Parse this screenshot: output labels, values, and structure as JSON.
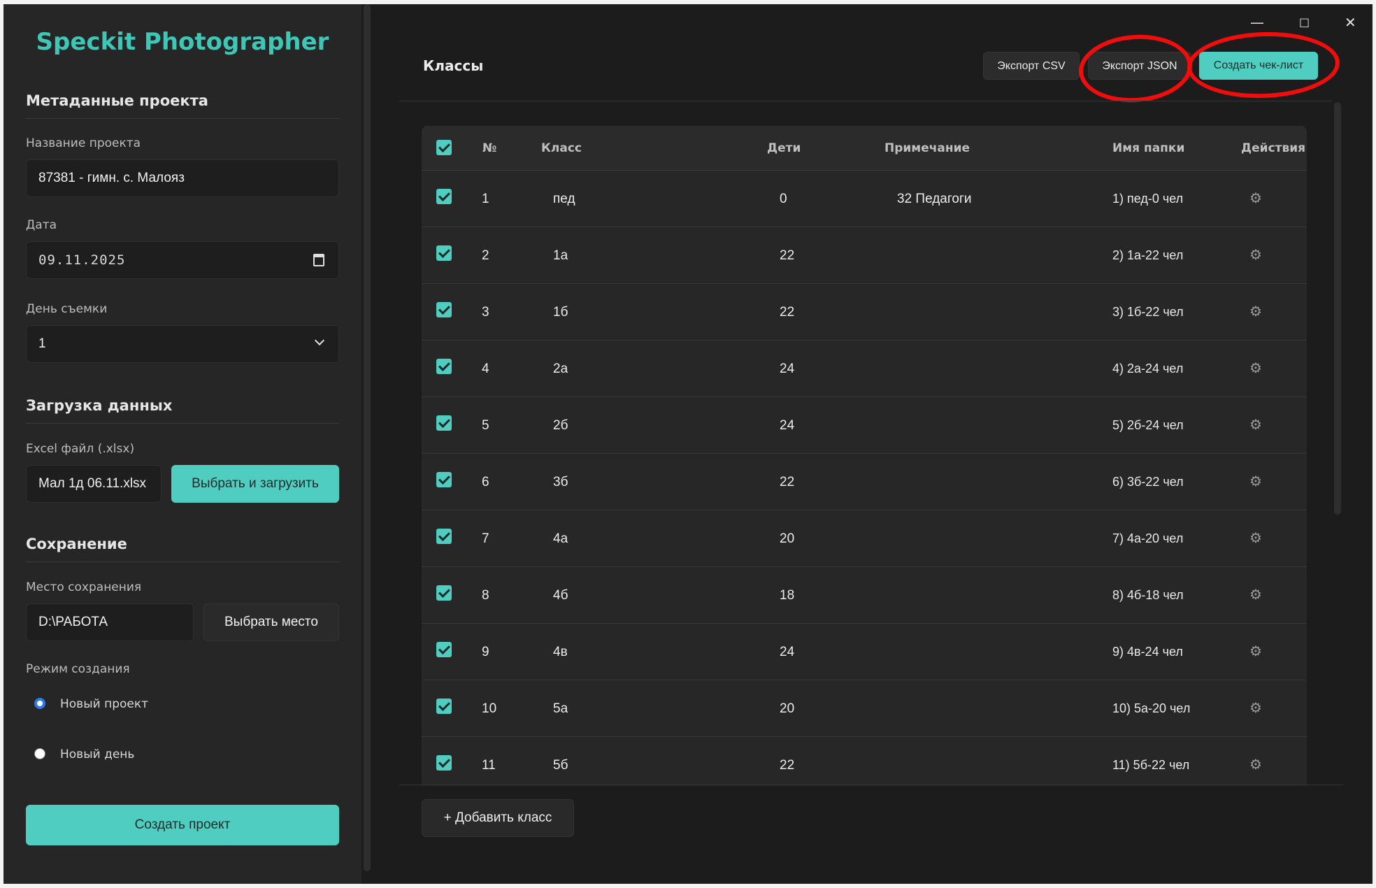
{
  "window": {
    "minimize_glyph": "—",
    "maximize_glyph": "□",
    "close_glyph": "✕"
  },
  "sidebar": {
    "app_title": "Speckit Photographer",
    "metadata": {
      "section_title": "Метаданные проекта",
      "project_name_label": "Название проекта",
      "project_name_value": "87381 - гимн. с. Малояз",
      "date_label": "Дата",
      "date_value": "09.11.2025",
      "shoot_day_label": "День съемки",
      "shoot_day_value": "1"
    },
    "upload": {
      "section_title": "Загрузка данных",
      "excel_label": "Excel файл (.xlsx)",
      "excel_value": "Мал 1д 06.11.xlsx",
      "select_upload_button": "Выбрать и загрузить"
    },
    "save": {
      "section_title": "Сохранение",
      "location_label": "Место сохранения",
      "location_value": "D:\\РАБОТА",
      "choose_location_button": "Выбрать место",
      "mode_label": "Режим создания",
      "mode_new_project": "Новый проект",
      "mode_new_day": "Новый день"
    },
    "create_project_button": "Создать проект"
  },
  "main": {
    "title": "Классы",
    "export_csv": "Экспорт CSV",
    "export_json": "Экспорт JSON",
    "create_checklist": "Создать чек-лист",
    "add_class_button": "+ Добавить класс"
  },
  "table": {
    "columns": [
      "№",
      "Класс",
      "Дети",
      "Примечание",
      "Имя папки",
      "Действия"
    ],
    "rows": [
      {
        "num": "1",
        "class": "пед",
        "children": "0",
        "note": "32 Педагоги",
        "folder": "1) пед-0 чел"
      },
      {
        "num": "2",
        "class": "1а",
        "children": "22",
        "note": "",
        "folder": "2) 1а-22 чел"
      },
      {
        "num": "3",
        "class": "1б",
        "children": "22",
        "note": "",
        "folder": "3) 1б-22 чел"
      },
      {
        "num": "4",
        "class": "2а",
        "children": "24",
        "note": "",
        "folder": "4) 2а-24 чел"
      },
      {
        "num": "5",
        "class": "2б",
        "children": "24",
        "note": "",
        "folder": "5) 2б-24 чел"
      },
      {
        "num": "6",
        "class": "3б",
        "children": "22",
        "note": "",
        "folder": "6) 3б-22 чел"
      },
      {
        "num": "7",
        "class": "4а",
        "children": "20",
        "note": "",
        "folder": "7) 4а-20 чел"
      },
      {
        "num": "8",
        "class": "4б",
        "children": "18",
        "note": "",
        "folder": "8) 4б-18 чел"
      },
      {
        "num": "9",
        "class": "4в",
        "children": "24",
        "note": "",
        "folder": "9) 4в-24 чел"
      },
      {
        "num": "10",
        "class": "5а",
        "children": "20",
        "note": "",
        "folder": "10) 5а-20 чел"
      },
      {
        "num": "11",
        "class": "5б",
        "children": "22",
        "note": "",
        "folder": "11) 5б-22 чел"
      }
    ],
    "action_icon": "gear-icon"
  },
  "colors": {
    "accent": "#4ecdc0",
    "brand": "#3ec6b6",
    "annotation": "#f20d0d",
    "background": "#1c1c1c",
    "sidebar": "#262626"
  }
}
